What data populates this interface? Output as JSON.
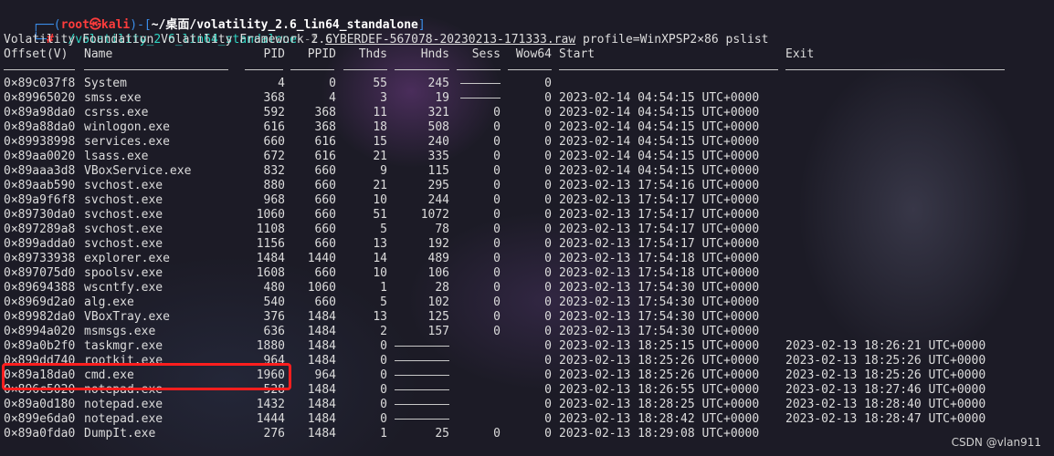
{
  "prompt": {
    "corner_top": "┌──(",
    "user": "root㉿kali",
    "after_user": ")-[",
    "cwd": "~/桌面/volatility_2.6_lin64_standalone",
    "close": "]",
    "corner_bottom": "└─",
    "hash": "#",
    "command": "./volatility_2.6_lin64_standalone",
    "flag": "-f",
    "file": "CYBERDEF-567078-20230213-171333.raw",
    "args": "profile=WinXPSP2×86 pslist"
  },
  "banner": "Volatility Foundation Volatility Framework 2.6",
  "columns": {
    "offset": "Offset(V)",
    "name": "Name",
    "pid": "PID",
    "ppid": "PPID",
    "thds": "Thds",
    "hnds": "Hnds",
    "sess": "Sess",
    "wow64": "Wow64",
    "start": "Start",
    "exit": "Exit"
  },
  "rows": [
    {
      "offset": "0×89c037f8",
      "name": "System",
      "pid": "4",
      "ppid": "0",
      "thds": "55",
      "hnds": "245",
      "sess": "",
      "wow64": "0",
      "start": "",
      "exit": ""
    },
    {
      "offset": "0×89965020",
      "name": "smss.exe",
      "pid": "368",
      "ppid": "4",
      "thds": "3",
      "hnds": "19",
      "sess": "",
      "wow64": "0",
      "start": "2023-02-14 04:54:15 UTC+0000",
      "exit": ""
    },
    {
      "offset": "0×89a98da0",
      "name": "csrss.exe",
      "pid": "592",
      "ppid": "368",
      "thds": "11",
      "hnds": "321",
      "sess": "0",
      "wow64": "0",
      "start": "2023-02-14 04:54:15 UTC+0000",
      "exit": ""
    },
    {
      "offset": "0×89a88da0",
      "name": "winlogon.exe",
      "pid": "616",
      "ppid": "368",
      "thds": "18",
      "hnds": "508",
      "sess": "0",
      "wow64": "0",
      "start": "2023-02-14 04:54:15 UTC+0000",
      "exit": ""
    },
    {
      "offset": "0×89938998",
      "name": "services.exe",
      "pid": "660",
      "ppid": "616",
      "thds": "15",
      "hnds": "240",
      "sess": "0",
      "wow64": "0",
      "start": "2023-02-14 04:54:15 UTC+0000",
      "exit": ""
    },
    {
      "offset": "0×89aa0020",
      "name": "lsass.exe",
      "pid": "672",
      "ppid": "616",
      "thds": "21",
      "hnds": "335",
      "sess": "0",
      "wow64": "0",
      "start": "2023-02-14 04:54:15 UTC+0000",
      "exit": ""
    },
    {
      "offset": "0×89aaa3d8",
      "name": "VBoxService.exe",
      "pid": "832",
      "ppid": "660",
      "thds": "9",
      "hnds": "115",
      "sess": "0",
      "wow64": "0",
      "start": "2023-02-14 04:54:15 UTC+0000",
      "exit": ""
    },
    {
      "offset": "0×89aab590",
      "name": "svchost.exe",
      "pid": "880",
      "ppid": "660",
      "thds": "21",
      "hnds": "295",
      "sess": "0",
      "wow64": "0",
      "start": "2023-02-13 17:54:16 UTC+0000",
      "exit": ""
    },
    {
      "offset": "0×89a9f6f8",
      "name": "svchost.exe",
      "pid": "968",
      "ppid": "660",
      "thds": "10",
      "hnds": "244",
      "sess": "0",
      "wow64": "0",
      "start": "2023-02-13 17:54:17 UTC+0000",
      "exit": ""
    },
    {
      "offset": "0×89730da0",
      "name": "svchost.exe",
      "pid": "1060",
      "ppid": "660",
      "thds": "51",
      "hnds": "1072",
      "sess": "0",
      "wow64": "0",
      "start": "2023-02-13 17:54:17 UTC+0000",
      "exit": ""
    },
    {
      "offset": "0×897289a8",
      "name": "svchost.exe",
      "pid": "1108",
      "ppid": "660",
      "thds": "5",
      "hnds": "78",
      "sess": "0",
      "wow64": "0",
      "start": "2023-02-13 17:54:17 UTC+0000",
      "exit": ""
    },
    {
      "offset": "0×899adda0",
      "name": "svchost.exe",
      "pid": "1156",
      "ppid": "660",
      "thds": "13",
      "hnds": "192",
      "sess": "0",
      "wow64": "0",
      "start": "2023-02-13 17:54:17 UTC+0000",
      "exit": ""
    },
    {
      "offset": "0×89733938",
      "name": "explorer.exe",
      "pid": "1484",
      "ppid": "1440",
      "thds": "14",
      "hnds": "489",
      "sess": "0",
      "wow64": "0",
      "start": "2023-02-13 17:54:18 UTC+0000",
      "exit": ""
    },
    {
      "offset": "0×897075d0",
      "name": "spoolsv.exe",
      "pid": "1608",
      "ppid": "660",
      "thds": "10",
      "hnds": "106",
      "sess": "0",
      "wow64": "0",
      "start": "2023-02-13 17:54:18 UTC+0000",
      "exit": ""
    },
    {
      "offset": "0×89694388",
      "name": "wscntfy.exe",
      "pid": "480",
      "ppid": "1060",
      "thds": "1",
      "hnds": "28",
      "sess": "0",
      "wow64": "0",
      "start": "2023-02-13 17:54:30 UTC+0000",
      "exit": ""
    },
    {
      "offset": "0×8969d2a0",
      "name": "alg.exe",
      "pid": "540",
      "ppid": "660",
      "thds": "5",
      "hnds": "102",
      "sess": "0",
      "wow64": "0",
      "start": "2023-02-13 17:54:30 UTC+0000",
      "exit": ""
    },
    {
      "offset": "0×89982da0",
      "name": "VBoxTray.exe",
      "pid": "376",
      "ppid": "1484",
      "thds": "13",
      "hnds": "125",
      "sess": "0",
      "wow64": "0",
      "start": "2023-02-13 17:54:30 UTC+0000",
      "exit": ""
    },
    {
      "offset": "0×8994a020",
      "name": "msmsgs.exe",
      "pid": "636",
      "ppid": "1484",
      "thds": "2",
      "hnds": "157",
      "sess": "0",
      "wow64": "0",
      "start": "2023-02-13 17:54:30 UTC+0000",
      "exit": ""
    },
    {
      "offset": "0×89a0b2f0",
      "name": "taskmgr.exe",
      "pid": "1880",
      "ppid": "1484",
      "thds": "0",
      "hnds": "",
      "sess": "",
      "wow64": "0",
      "start": "2023-02-13 18:25:15 UTC+0000",
      "exit": "2023-02-13 18:26:21 UTC+0000"
    },
    {
      "offset": "0×899dd740",
      "name": "rootkit.exe",
      "pid": "964",
      "ppid": "1484",
      "thds": "0",
      "hnds": "",
      "sess": "",
      "wow64": "0",
      "start": "2023-02-13 18:25:26 UTC+0000",
      "exit": "2023-02-13 18:25:26 UTC+0000"
    },
    {
      "offset": "0×89a18da0",
      "name": "cmd.exe",
      "pid": "1960",
      "ppid": "964",
      "thds": "0",
      "hnds": "",
      "sess": "",
      "wow64": "0",
      "start": "2023-02-13 18:25:26 UTC+0000",
      "exit": "2023-02-13 18:25:26 UTC+0000"
    },
    {
      "offset": "0×896c5020",
      "name": "notepad.exe",
      "pid": "528",
      "ppid": "1484",
      "thds": "0",
      "hnds": "",
      "sess": "",
      "wow64": "0",
      "start": "2023-02-13 18:26:55 UTC+0000",
      "exit": "2023-02-13 18:27:46 UTC+0000"
    },
    {
      "offset": "0×89a0d180",
      "name": "notepad.exe",
      "pid": "1432",
      "ppid": "1484",
      "thds": "0",
      "hnds": "",
      "sess": "",
      "wow64": "0",
      "start": "2023-02-13 18:28:25 UTC+0000",
      "exit": "2023-02-13 18:28:40 UTC+0000"
    },
    {
      "offset": "0×899e6da0",
      "name": "notepad.exe",
      "pid": "1444",
      "ppid": "1484",
      "thds": "0",
      "hnds": "",
      "sess": "",
      "wow64": "0",
      "start": "2023-02-13 18:28:42 UTC+0000",
      "exit": "2023-02-13 18:28:47 UTC+0000"
    },
    {
      "offset": "0×89a0fda0",
      "name": "DumpIt.exe",
      "pid": "276",
      "ppid": "1484",
      "thds": "1",
      "hnds": "25",
      "sess": "0",
      "wow64": "0",
      "start": "2023-02-13 18:29:08 UTC+0000",
      "exit": ""
    }
  ],
  "watermark": "CSDN @vlan911",
  "colors": {
    "prompt_user": "#ff3c3c",
    "prompt_frame": "#3b8eea",
    "command": "#2fd5c2",
    "highlight_box": "#ff1e1e",
    "terminal_bg": "#1e1c2a"
  }
}
